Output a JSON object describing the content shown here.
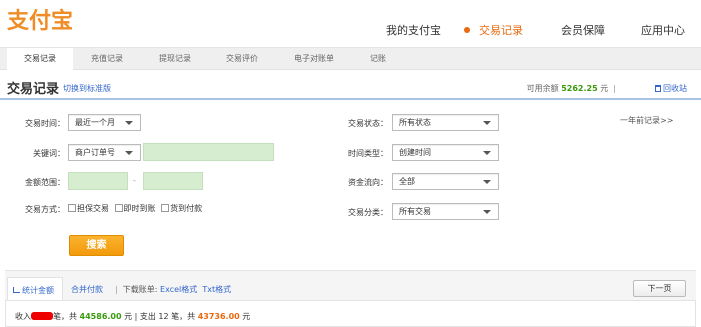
{
  "logo": {
    "text": "支付宝",
    "color": "#f08c26"
  },
  "topnav": [
    {
      "label": "我的支付宝",
      "active": false
    },
    {
      "label": "交易记录",
      "active": true
    },
    {
      "label": "会员保障",
      "active": false
    },
    {
      "label": "应用中心",
      "active": false
    }
  ],
  "subnav": [
    {
      "label": "交易记录",
      "active": true
    },
    {
      "label": "充值记录"
    },
    {
      "label": "提现记录"
    },
    {
      "label": "交易评价"
    },
    {
      "label": "电子对账单"
    },
    {
      "label": "记账"
    }
  ],
  "header": {
    "title": "交易记录",
    "switch_link": "切换到标准版",
    "balance_label": "可用余额",
    "balance_amount": "5262.25",
    "balance_unit": "元",
    "separator": "|",
    "recycle_label": "回收站"
  },
  "filters": {
    "time_label": "交易时间：",
    "time_value": "最近一个月",
    "keyword_label": "关键词：",
    "keyword_select": "商户订单号",
    "amount_label": "金额范围：",
    "amount_dash": "-",
    "method_label": "交易方式：",
    "methods": [
      "担保交易",
      "即时到账",
      "货到付款"
    ],
    "status_label": "交易状态：",
    "status_value": "所有状态",
    "time_type_label": "时间类型：",
    "time_type_value": "创建时间",
    "flow_label": "资金流向：",
    "flow_value": "全部",
    "category_label": "交易分类：",
    "category_value": "所有交易",
    "year_link": "一年前记录>>"
  },
  "search_button": "搜索",
  "bottom": {
    "stats_tab": "统计金额",
    "merge_pay": "合并付款",
    "download_label": "下载账单:",
    "excel": "Excel格式",
    "txt": "Txt格式",
    "next_page": "下一页"
  },
  "summary": {
    "income_prefix": "收入",
    "income_mid": "笔，共",
    "income_amount": "44586.00",
    "income_suffix": "元 | 支出 12 笔，共",
    "expense_amount": "43736.00",
    "expense_suffix": "元"
  }
}
